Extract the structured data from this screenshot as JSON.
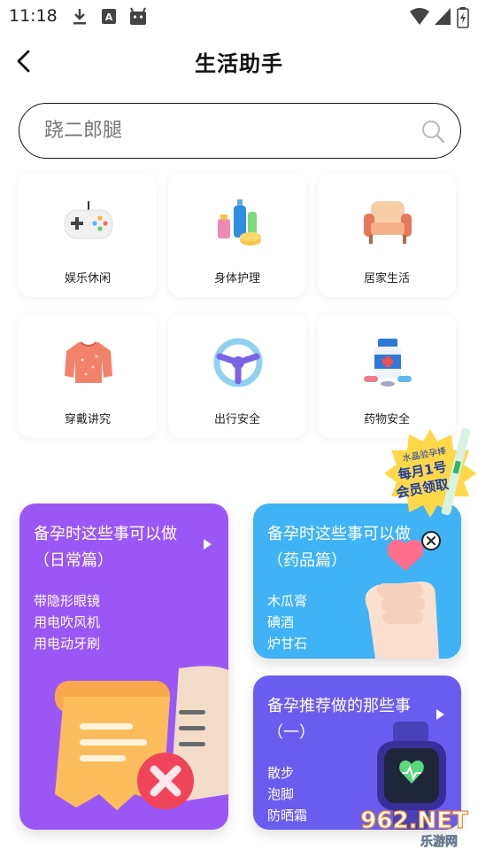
{
  "status_bar": {
    "time": "11:18",
    "icons": [
      "download-icon",
      "font-icon",
      "android-icon",
      "wifi-icon",
      "signal-icon",
      "battery-icon"
    ]
  },
  "header": {
    "back_icon": "back-arrow-icon",
    "title": "生活助手"
  },
  "search": {
    "placeholder": "跷二郎腿",
    "icon": "search-icon"
  },
  "categories": [
    {
      "label": "娱乐休闲",
      "icon": "gamepad-icon"
    },
    {
      "label": "身体护理",
      "icon": "skincare-bottles-icon"
    },
    {
      "label": "居家生活",
      "icon": "armchair-icon"
    },
    {
      "label": "穿戴讲究",
      "icon": "sweater-icon"
    },
    {
      "label": "出行安全",
      "icon": "steering-wheel-icon"
    },
    {
      "label": "药物安全",
      "icon": "medicine-bottle-icon"
    }
  ],
  "promo": {
    "line1": "水晶验孕棒",
    "line2": "每月1号",
    "line3": "会员领取"
  },
  "cards": [
    {
      "title": "备孕时这些事可以做（日常篇）",
      "items": [
        "带隐形眼镜",
        "用电吹风机",
        "用电动牙刷"
      ],
      "color": "#9b57f5"
    },
    {
      "title": "备孕时这些事可以做（药品篇）",
      "items": [
        "木瓜膏",
        "碘酒",
        "炉甘石"
      ],
      "color": "#3fb3f5"
    },
    {
      "title": "备孕推荐做的那些事（一）",
      "items": [
        "散步",
        "泡脚",
        "防晒霜"
      ],
      "color": "#6b5cf0"
    }
  ],
  "watermark": {
    "logo": "962.NET",
    "site": "乐游网"
  }
}
